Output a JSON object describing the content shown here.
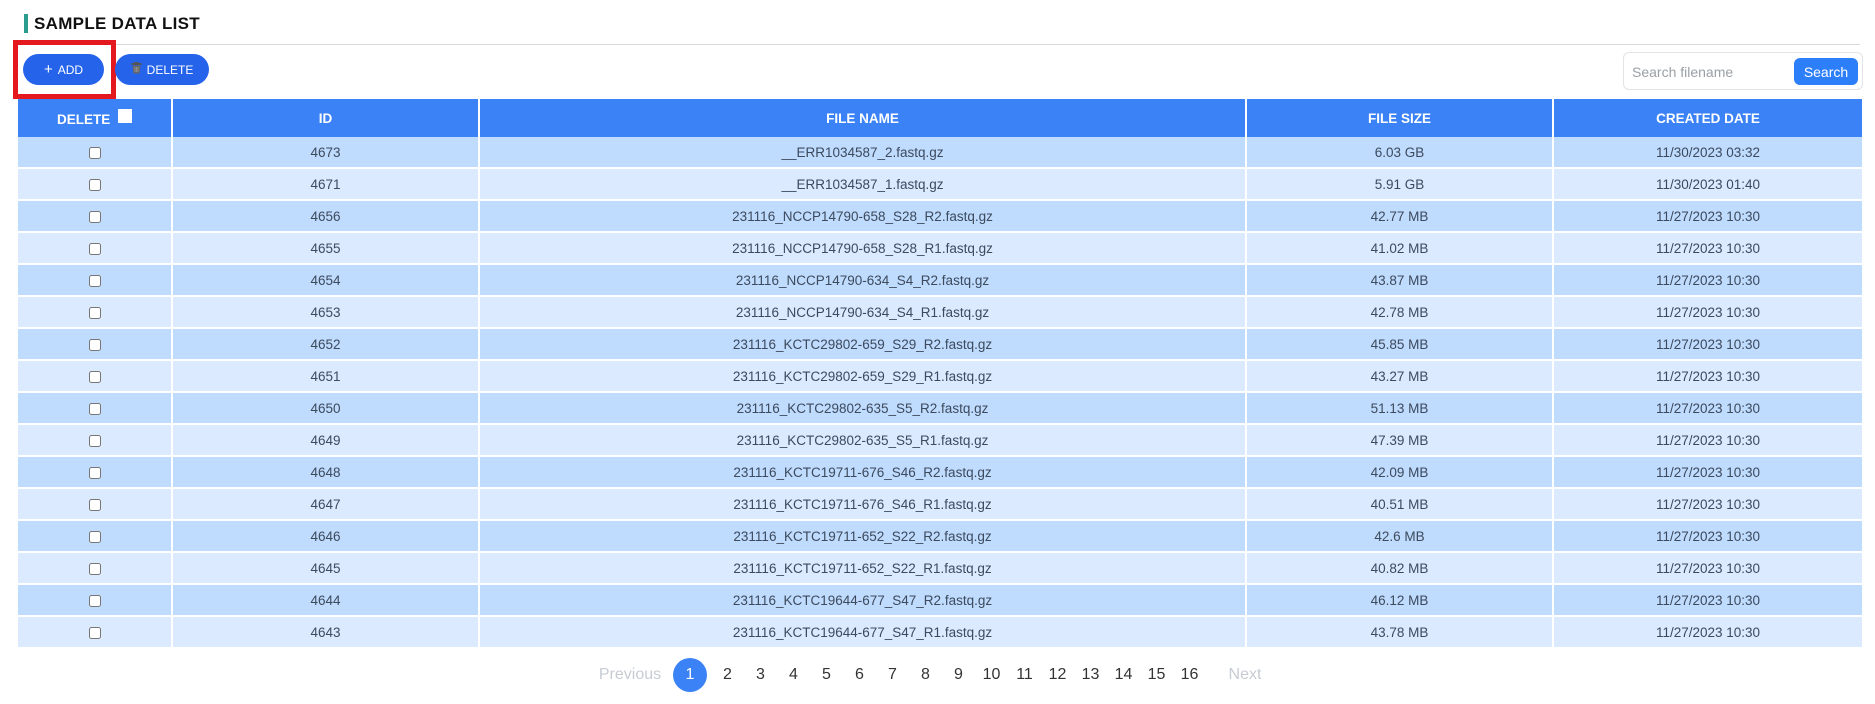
{
  "header": {
    "title": "SAMPLE DATA LIST"
  },
  "toolbar": {
    "add_label": "ADD",
    "delete_label": "DELETE",
    "add_icon": "plus-icon",
    "delete_icon": "trash-icon",
    "search_placeholder": "Search filename",
    "search_value": "",
    "search_button_label": "Search"
  },
  "table": {
    "columns": [
      "DELETE",
      "ID",
      "FILE NAME",
      "FILE SIZE",
      "CREATED DATE"
    ],
    "rows": [
      {
        "id": "4673",
        "file_name": "__ERR1034587_2.fastq.gz",
        "file_size": "6.03 GB",
        "created": "11/30/2023 03:32"
      },
      {
        "id": "4671",
        "file_name": "__ERR1034587_1.fastq.gz",
        "file_size": "5.91 GB",
        "created": "11/30/2023 01:40"
      },
      {
        "id": "4656",
        "file_name": "231116_NCCP14790-658_S28_R2.fastq.gz",
        "file_size": "42.77 MB",
        "created": "11/27/2023 10:30"
      },
      {
        "id": "4655",
        "file_name": "231116_NCCP14790-658_S28_R1.fastq.gz",
        "file_size": "41.02 MB",
        "created": "11/27/2023 10:30"
      },
      {
        "id": "4654",
        "file_name": "231116_NCCP14790-634_S4_R2.fastq.gz",
        "file_size": "43.87 MB",
        "created": "11/27/2023 10:30"
      },
      {
        "id": "4653",
        "file_name": "231116_NCCP14790-634_S4_R1.fastq.gz",
        "file_size": "42.78 MB",
        "created": "11/27/2023 10:30"
      },
      {
        "id": "4652",
        "file_name": "231116_KCTC29802-659_S29_R2.fastq.gz",
        "file_size": "45.85 MB",
        "created": "11/27/2023 10:30"
      },
      {
        "id": "4651",
        "file_name": "231116_KCTC29802-659_S29_R1.fastq.gz",
        "file_size": "43.27 MB",
        "created": "11/27/2023 10:30"
      },
      {
        "id": "4650",
        "file_name": "231116_KCTC29802-635_S5_R2.fastq.gz",
        "file_size": "51.13 MB",
        "created": "11/27/2023 10:30"
      },
      {
        "id": "4649",
        "file_name": "231116_KCTC29802-635_S5_R1.fastq.gz",
        "file_size": "47.39 MB",
        "created": "11/27/2023 10:30"
      },
      {
        "id": "4648",
        "file_name": "231116_KCTC19711-676_S46_R2.fastq.gz",
        "file_size": "42.09 MB",
        "created": "11/27/2023 10:30"
      },
      {
        "id": "4647",
        "file_name": "231116_KCTC19711-676_S46_R1.fastq.gz",
        "file_size": "40.51 MB",
        "created": "11/27/2023 10:30"
      },
      {
        "id": "4646",
        "file_name": "231116_KCTC19711-652_S22_R2.fastq.gz",
        "file_size": "42.6 MB",
        "created": "11/27/2023 10:30"
      },
      {
        "id": "4645",
        "file_name": "231116_KCTC19711-652_S22_R1.fastq.gz",
        "file_size": "40.82 MB",
        "created": "11/27/2023 10:30"
      },
      {
        "id": "4644",
        "file_name": "231116_KCTC19644-677_S47_R2.fastq.gz",
        "file_size": "46.12 MB",
        "created": "11/27/2023 10:30"
      },
      {
        "id": "4643",
        "file_name": "231116_KCTC19644-677_S47_R1.fastq.gz",
        "file_size": "43.78 MB",
        "created": "11/27/2023 10:30"
      }
    ]
  },
  "pagination": {
    "previous_label": "Previous",
    "next_label": "Next",
    "pages": [
      "1",
      "2",
      "3",
      "4",
      "5",
      "6",
      "7",
      "8",
      "9",
      "10",
      "11",
      "12",
      "13",
      "14",
      "15",
      "16"
    ],
    "current": "1"
  },
  "colors": {
    "header_bg": "#3b82f6",
    "row_odd": "#bfdbfe",
    "row_even": "#dbeafe",
    "button_bg": "#2563eb",
    "highlight": "#e3191f",
    "title_accent": "#2a9d8f"
  }
}
